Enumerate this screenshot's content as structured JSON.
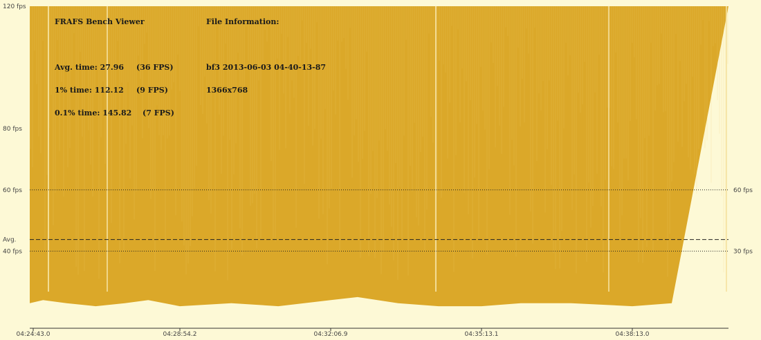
{
  "viewer": {
    "title": "FRAFS Bench Viewer",
    "stats": [
      {
        "label": "Avg. time: 27.96",
        "fps": "(36 FPS)"
      },
      {
        "label": "1% time: 112.12",
        "fps": "(9 FPS)"
      },
      {
        "label": "0.1% time: 145.82",
        "fps": "(7 FPS)"
      }
    ]
  },
  "file_info": {
    "heading": "File Information:",
    "name": "bf3 2013-06-03 04-40-13-87",
    "resolution": "1366x768"
  },
  "colors": {
    "background": "#fdf9d6",
    "series": "#dba829",
    "series_light": "#f0cf6e",
    "gridline": "#222222"
  },
  "chart_data": {
    "type": "area",
    "title": "",
    "ylim": [
      20,
      120
    ],
    "y_ticks_left": [
      {
        "value": 120,
        "label": "120 fps"
      },
      {
        "value": 80,
        "label": "80 fps"
      },
      {
        "value": 60,
        "label": "60 fps"
      },
      {
        "value": 40,
        "label": "40 fps"
      }
    ],
    "y_ticks_right": [
      {
        "value": 60,
        "label": "60 fps"
      },
      {
        "value": 40,
        "label": "30 fps"
      }
    ],
    "avg_line": {
      "value": 43.8,
      "label": "Avg."
    },
    "x_tick_labels": [
      "04:24:43.0",
      "04:28:54.2",
      "04:32:06.9",
      "04:35:13.1",
      "04:38:13.0"
    ],
    "grid": "dotted at 60 and 40 fps; dashed at average",
    "series": [
      {
        "min_envelope": {
          "x": [
            "04:24:43.0",
            "04:25:00.0",
            "04:25:40.0",
            "04:26:30.0",
            "04:27:20.0",
            "04:28:00.0",
            "04:28:54.2",
            "04:30:00.0",
            "04:31:00.0",
            "04:32:06.9",
            "04:32:40.0",
            "04:33:30.0",
            "04:34:20.0",
            "04:35:13.1",
            "04:36:00.0",
            "04:37:00.0",
            "04:38:13.0",
            "04:39:00.0"
          ],
          "fps": [
            23,
            24,
            23,
            22,
            23,
            24,
            22,
            23,
            22,
            24,
            25,
            23,
            22,
            22,
            23,
            23,
            22,
            23
          ]
        },
        "max_fps": 120
      }
    ]
  }
}
